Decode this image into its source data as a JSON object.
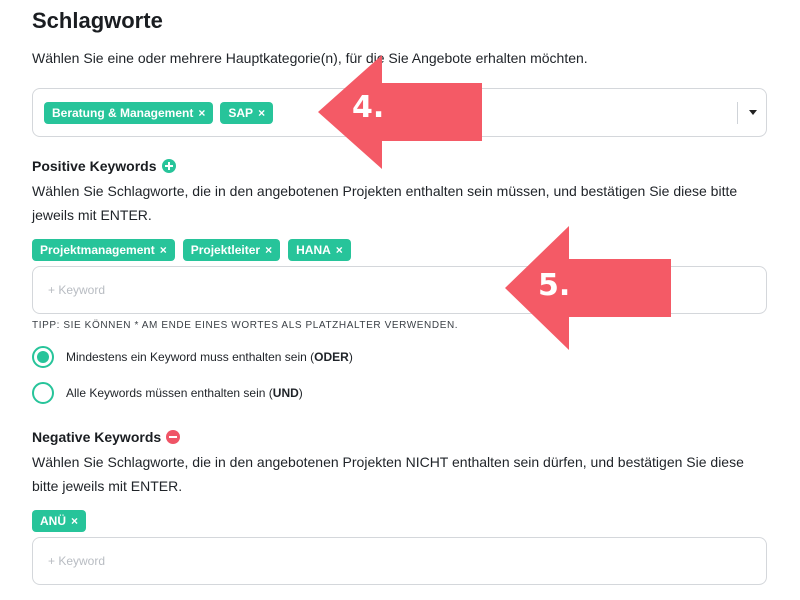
{
  "page": {
    "title": "Schlagworte",
    "intro": "Wählen Sie eine oder mehrere Hauptkategorie(n), für die Sie Angebote erhalten möchten."
  },
  "categories": {
    "tags": [
      {
        "label": "Beratung & Management"
      },
      {
        "label": "SAP"
      }
    ]
  },
  "positive": {
    "title": "Positive Keywords",
    "description": "Wählen Sie Schlagworte, die in den angebotenen Projekten enthalten sein müssen, und bestätigen Sie diese bitte jeweils mit ENTER.",
    "tags": [
      {
        "label": "Projektmanagement"
      },
      {
        "label": "Projektleiter"
      },
      {
        "label": "HANA"
      }
    ],
    "input_placeholder": "+ Keyword",
    "tip": "TIPP: SIE KÖNNEN * AM ENDE EINES WORTES ALS PLATZHALTER VERWENDEN.",
    "option_or": {
      "text": "Mindestens ein Keyword muss enthalten sein (",
      "bold": "ODER",
      "close": ")"
    },
    "option_and": {
      "text": "Alle Keywords müssen enthalten sein (",
      "bold": "UND",
      "close": ")"
    }
  },
  "negative": {
    "title": "Negative Keywords",
    "description": "Wählen Sie Schlagworte, die in den angebotenen Projekten NICHT enthalten sein dürfen, und bestätigen Sie diese bitte jeweils mit ENTER.",
    "tags": [
      {
        "label": "ANÜ"
      }
    ],
    "input_placeholder": "+ Keyword"
  },
  "tag_remove_symbol": "×",
  "annotations": {
    "step4": "4.",
    "step5": "5."
  },
  "colors": {
    "accent": "#27c49a",
    "negative": "#ef5466",
    "arrow": "#f45a66"
  }
}
